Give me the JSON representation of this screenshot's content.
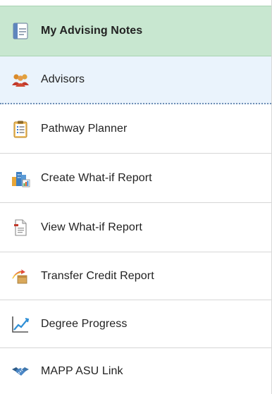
{
  "nav": {
    "items": [
      {
        "label": "My Advising Notes",
        "icon": "notes-icon",
        "state": "active"
      },
      {
        "label": "Advisors",
        "icon": "advisors-people-icon",
        "state": "hover"
      },
      {
        "label": "Pathway Planner",
        "icon": "clipboard-checklist-icon",
        "state": "normal"
      },
      {
        "label": "Create What-if Report",
        "icon": "buildings-chart-icon",
        "state": "normal"
      },
      {
        "label": "View What-if Report",
        "icon": "document-icon",
        "state": "normal"
      },
      {
        "label": "Transfer Credit Report",
        "icon": "transfer-box-icon",
        "state": "normal"
      },
      {
        "label": "Degree Progress",
        "icon": "line-chart-icon",
        "state": "normal"
      },
      {
        "label": "MAPP ASU Link",
        "icon": "handshake-icon",
        "state": "normal"
      }
    ]
  },
  "colors": {
    "active_bg": "#c8e7d0",
    "hover_bg": "#eaf3fc",
    "divider": "#d6d6d6",
    "text": "#222222"
  }
}
